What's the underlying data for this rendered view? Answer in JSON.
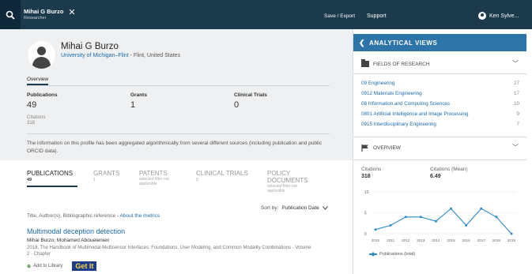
{
  "topbar": {
    "chip_name": "Mihai G Burzo",
    "chip_role": "Researcher",
    "save_export": "Save / Export",
    "support": "Support",
    "user_name": "Ken Sylve..."
  },
  "profile": {
    "name": "Mihai G Burzo",
    "affiliation_link": "University of Michigan–Flint",
    "affiliation_rest": " - Flint, United States",
    "tab_overview": "Overview",
    "metrics": [
      {
        "label": "Publications",
        "value": "49"
      },
      {
        "label": "Grants",
        "value": "1"
      },
      {
        "label": "Clinical Trials",
        "value": "0"
      }
    ],
    "citations_label": "Citations",
    "citations_value": "318",
    "info": "The information on this profile has been aggregated algorithmically from several different sources (including publication and public ORCID data)."
  },
  "tabs": [
    {
      "label": "PUBLICATIONS",
      "count": "49",
      "sub": ""
    },
    {
      "label": "GRANTS",
      "count": "1",
      "sub": ""
    },
    {
      "label": "PATENTS",
      "count": "",
      "sub": "selected filter not applicable"
    },
    {
      "label": "CLINICAL TRIALS",
      "count": "0",
      "sub": ""
    },
    {
      "label": "POLICY DOCUMENTS",
      "count": "",
      "sub": "selected filter not applicable"
    }
  ],
  "results": {
    "head_text": "Title, Author(s), Bibliographic reference - ",
    "head_link": "About the metrics",
    "sort_label": "Sort by:",
    "sort_value": "Publication Date",
    "publication": {
      "title": "Multimodal deception detection",
      "authors": "Mihai Burzo, Mohamed Abouelenien",
      "source": "2018, The Handbook of Multimodal-Multisensor Interfaces: Foundations, User Modeling, and Common Modality Combinations - Volume 2 - Chapter",
      "add_library": "Add to Library",
      "getit": "Get It"
    }
  },
  "side": {
    "title": "ANALYTICAL VIEWS",
    "fields_title": "FIELDS OF RESEARCH",
    "fields": [
      {
        "label": "09 Engineering",
        "count": "27"
      },
      {
        "label": "0912 Materials Engineering",
        "count": "17"
      },
      {
        "label": "08 Information and Computing Sciences",
        "count": "10"
      },
      {
        "label": "0801 Artificial Intelligence and Image Processing",
        "count": "9"
      },
      {
        "label": "0915 Interdisciplinary Engineering",
        "count": "7"
      }
    ],
    "overview_title": "OVERVIEW",
    "citations_label": "Citations",
    "citations_value": "318",
    "mean_label": "Citations (Mean)",
    "mean_value": "6.49"
  },
  "chart_data": {
    "type": "line",
    "x": [
      "2010",
      "2011",
      "2012",
      "2013",
      "2014",
      "2015",
      "2016",
      "2017",
      "2018",
      "2019"
    ],
    "series": [
      {
        "name": "Publications (total)",
        "values": [
          1,
          2,
          4,
          4,
          3,
          6,
          2,
          6,
          4,
          0
        ]
      }
    ],
    "yticks": [
      "10",
      "5",
      "0"
    ],
    "ylim": [
      0,
      10
    ],
    "grid": true,
    "legend": "bottom",
    "color": "#2d8bc9"
  }
}
